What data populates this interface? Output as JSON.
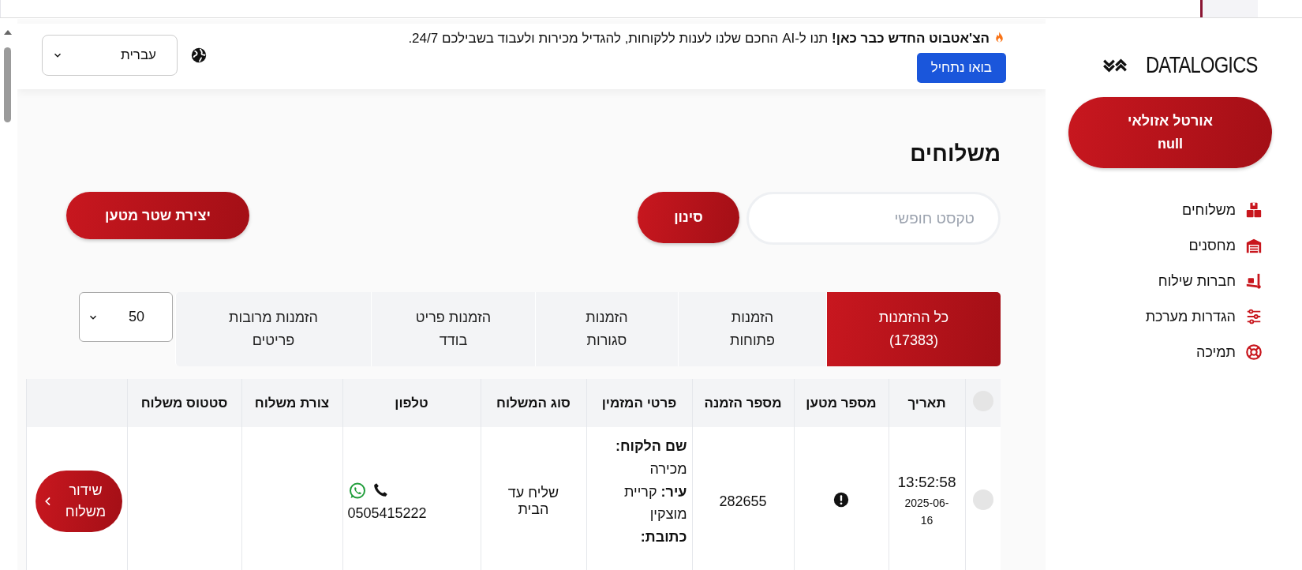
{
  "banner": {
    "message": "**הצ'אטבוט החדש כבר כאן!** תנו ל-AI החכם שלנו לענות ללקוחות, להגדיל מכירות ולעבוד בשבילכם 24/7.",
    "button": "בואו נתחיל",
    "language": "עברית"
  },
  "sidebar": {
    "logo": "DATALOGICS",
    "user": {
      "name": "אורטל אזולאי",
      "role": "null"
    },
    "items": [
      {
        "label": "משלוחים"
      },
      {
        "label": "מחסנים"
      },
      {
        "label": "חברות שילוח"
      },
      {
        "label": "הגדרות מערכת"
      },
      {
        "label": "תמיכה"
      }
    ]
  },
  "page": {
    "title": "משלוחים",
    "search_placeholder": "טקסט חופשי",
    "filter_button": "סינון",
    "create_button": "יצירת שטר מטען",
    "tabs": [
      {
        "lines": [
          "כל ההזמנות",
          "(17383)"
        ],
        "selected": true
      },
      {
        "lines": [
          "הזמנות",
          "פתוחות"
        ],
        "selected": false
      },
      {
        "lines": [
          "הזמנות",
          "סגורות"
        ],
        "selected": false
      },
      {
        "lines": [
          "הזמנות פריט",
          "בודד"
        ],
        "selected": false
      },
      {
        "lines": [
          "הזמנות מרובות",
          "פריטים"
        ],
        "selected": false
      }
    ],
    "page_size": "50"
  },
  "table": {
    "columns": [
      "תאריך",
      "מספר מטען",
      "מספר הזמנה",
      "פרטי המזמין",
      "סוג המשלוח",
      "טלפון",
      "צורת משלוח",
      "סטטוס משלוח"
    ],
    "all_selected": false,
    "rows": [
      {
        "selected": false,
        "time": "13:52:58",
        "date": "2025-06-16",
        "shipment_missing": true,
        "order_number": "282655",
        "customer": [
          "**שם הלקוח:**",
          "מכירה",
          "**עיר:** קריית מוצקין",
          "**כתובת:**"
        ],
        "delivery_type": "שליח עד הבית",
        "phone": "0505415222",
        "action": "שידור משלוח"
      }
    ]
  }
}
